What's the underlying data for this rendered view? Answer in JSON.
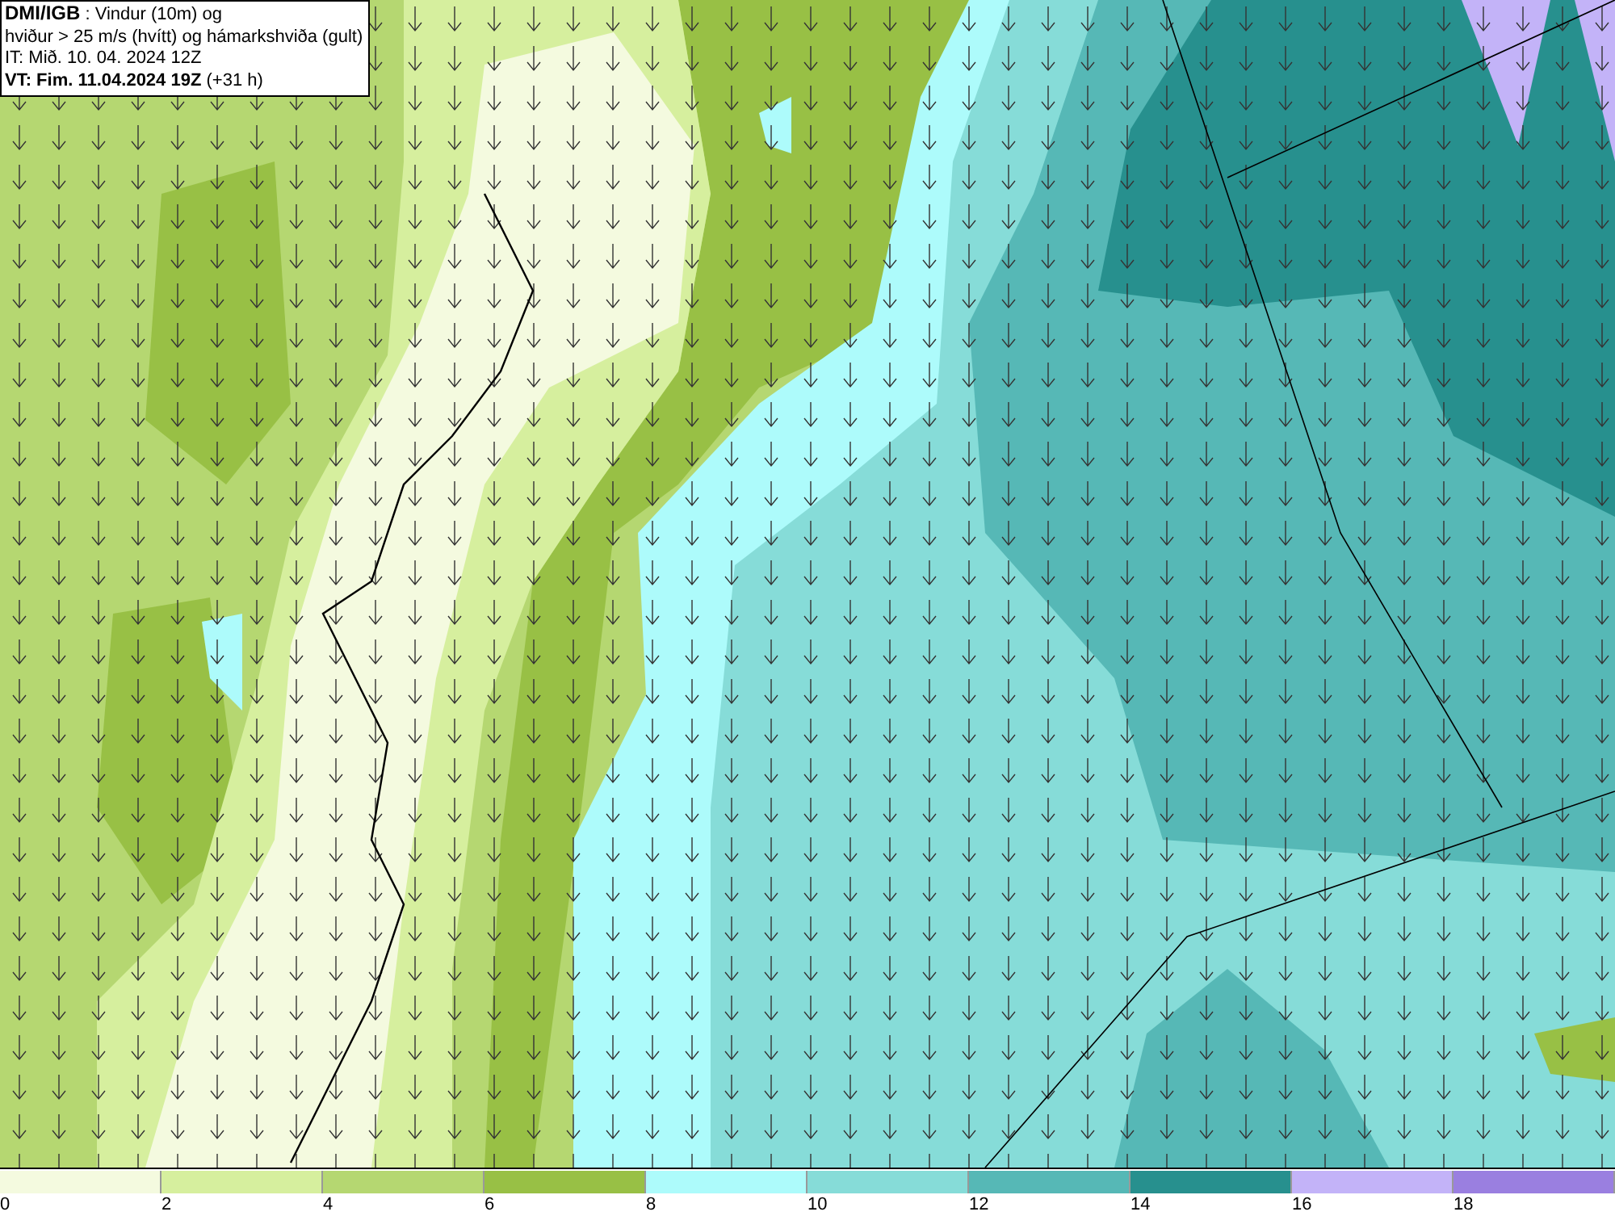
{
  "title_box": {
    "lines": [
      "**DMI/IGB** : Vindur (10m) og",
      "hviður > 25 m/s (hvítt) og hámarkshviða (gult)",
      "IT: Mið. 10. 04. 2024 12Z",
      "**VT: Fim. 11.04.2024 19Z** (+31 h)"
    ]
  },
  "legend": [
    {
      "label": "0",
      "color": "#f4fadf"
    },
    {
      "label": "2",
      "color": "#d6ef9e"
    },
    {
      "label": "4",
      "color": "#b5d771"
    },
    {
      "label": "6",
      "color": "#98c045"
    },
    {
      "label": "8",
      "color": "#adfbfb"
    },
    {
      "label": "10",
      "color": "#86dcd8"
    },
    {
      "label": "12",
      "color": "#56b8b6"
    },
    {
      "label": "14",
      "color": "#27908e"
    },
    {
      "label": "16",
      "color": "#c3b3f8"
    },
    {
      "label": "18",
      "color": "#9a7fe0"
    }
  ]
}
